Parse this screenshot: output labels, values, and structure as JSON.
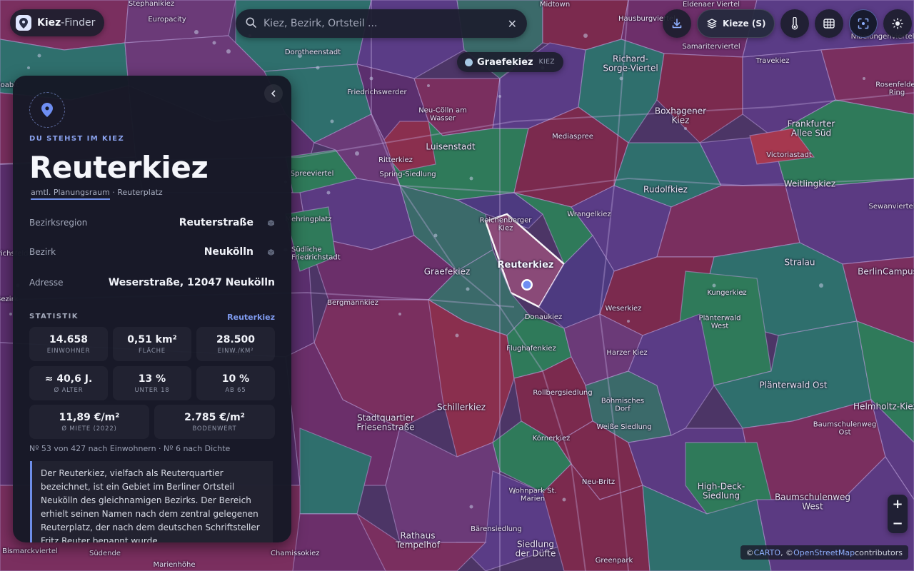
{
  "app": {
    "brand_bold": "Kiez",
    "brand_light": "-Finder"
  },
  "search": {
    "placeholder": "Kiez, Bezirk, Ortsteil ...",
    "value": ""
  },
  "toolbar": {
    "layers_label": "Kieze (S)"
  },
  "hover_tag": {
    "name": "Graefekiez",
    "kind": "KIEZ"
  },
  "panel": {
    "eyebrow": "DU STEHST IM KIEZ",
    "title": "Reuterkiez",
    "subtitle_underlined": "amtl. Planungsraum",
    "subtitle_rest": " · Reuterplatz",
    "fields": [
      {
        "label": "Bezirksregion",
        "value": "Reuterstraße"
      },
      {
        "label": "Bezirk",
        "value": "Neukölln"
      },
      {
        "label": "Adresse",
        "value": "Weserstraße, 12047 Neukölln"
      }
    ],
    "stats_heading": "STATISTIK",
    "stats_link": "Reuterkiez",
    "stats": [
      {
        "value": "14.658",
        "label": "EINWOHNER"
      },
      {
        "value": "0,51 km²",
        "label": "FLÄCHE"
      },
      {
        "value": "28.500",
        "label": "EINW./KM²"
      },
      {
        "value": "≈ 40,6 J.",
        "label": "Ø ALTER"
      },
      {
        "value": "13 %",
        "label": "UNTER 18"
      },
      {
        "value": "10 %",
        "label": "AB 65"
      },
      {
        "value": "11,89 €/m²",
        "label": "Ø MIETE (2022)"
      },
      {
        "value": "2.785 €/m²",
        "label": "BODENWERT"
      }
    ],
    "rank": "Nº 53 von 427 nach Einwohnern · Nº 6 nach Dichte",
    "description": "Der Reuterkiez, vielfach als Reuterquartier bezeichnet, ist ein Gebiet im Berliner Ortsteil Neukölln des gleichnamigen Bezirks. Der Bereich erhielt seinen Namen nach dem zentral gelegenen Reuterplatz, der nach dem deutschen Schriftsteller Fritz Reuter benannt wurde."
  },
  "map": {
    "selected_label": "Reuterkiez",
    "labels": [
      "Stephanikiez",
      "Europacity",
      "Dorotheenstadt",
      "Friedrichswerder",
      "Neu-Cölln am Wasser",
      "Luisenstadt",
      "Ritterkiez",
      "Spring-Siedlung",
      "Mediaspree",
      "Reichenberger Kiez",
      "Wrangelkiez",
      "Graefekiez",
      "Bergmannkiez",
      "Donaukiez",
      "Weserkiez",
      "Flughafenkiez",
      "Harzer Kiez",
      "Schillerkiez",
      "Rollbergsiedlung",
      "Böhmisches Dorf",
      "Weiße Siedlung",
      "Körnerkiez",
      "Stadtquartier Friesenstraße",
      "Wohnpark St. Marien",
      "Neu-Britz",
      "Rathaus Tempelhof",
      "Siedlung der Düfte",
      "Bärensiedlung",
      "Greenpark",
      "Südende",
      "Bismarckviertel",
      "Marienhöhe",
      "Midtown",
      "Eldenaer Viertel",
      "Samariterviertel",
      "Hausburgviertel",
      "Richard-Sorge-Viertel",
      "Boxhagener Kiez",
      "Travekiez",
      "Nibelungenviertel",
      "Rosenfelder Ring",
      "Frankfurter Allee Süd",
      "Victoriastadt",
      "Rudolfkiez",
      "Weitlingkiez",
      "Sewanviertel",
      "Stralau",
      "BerlinCampus",
      "Kungerkiez",
      "Plänterwald West",
      "Plänterwald Ost",
      "Helmholtz-Kiez",
      "Baumschulenweg Ost",
      "High-Deck-Siedlung",
      "Baumschulenweg West",
      "Moabit",
      "Spreeviertel",
      "Friedrichsfelde",
      "Bezirk",
      "Südliche Friedrichstadt",
      "Mehringplatz",
      "Chamissokiez"
    ]
  },
  "attribution": {
    "prefix": "© ",
    "carto": "CARTO",
    "sep": ", © ",
    "osm": "OpenStreetMap",
    "suffix": " contributors"
  }
}
